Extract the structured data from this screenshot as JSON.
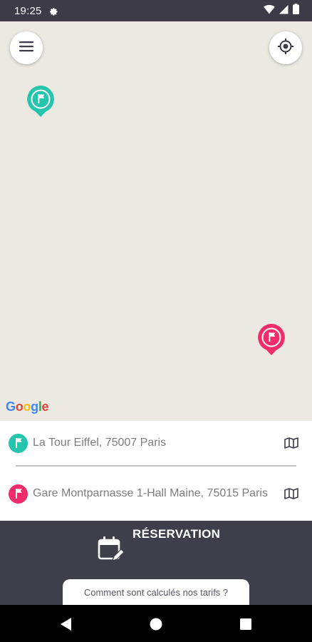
{
  "status_bar": {
    "time": "19:25",
    "icons": [
      "gear-icon",
      "wifi-icon",
      "signal-icon",
      "battery-icon"
    ]
  },
  "map": {
    "provider_logo": [
      "G",
      "o",
      "o",
      "g",
      "l",
      "e"
    ],
    "logo_colors": [
      "#4285F4",
      "#EA4335",
      "#FBBC05",
      "#4285F4",
      "#34A853",
      "#EA4335"
    ],
    "markers": [
      {
        "name": "departure",
        "color": "#25c4ad",
        "icon": "flag-icon"
      },
      {
        "name": "arrival",
        "color": "#f02d6a",
        "icon": "flag-icon"
      }
    ]
  },
  "addresses": {
    "departure": "La Tour Eiffel, 75007 Paris",
    "arrival": "Gare Montparnasse 1-Hall Maine, 75015 Paris"
  },
  "reservation": {
    "label": "RÉSERVATION",
    "tarif_link": "Comment sont calculés nos tarifs ?"
  },
  "colors": {
    "accent_green": "#25c4ad",
    "accent_red": "#f02d6a",
    "bar_dark": "#3f3e4b"
  }
}
